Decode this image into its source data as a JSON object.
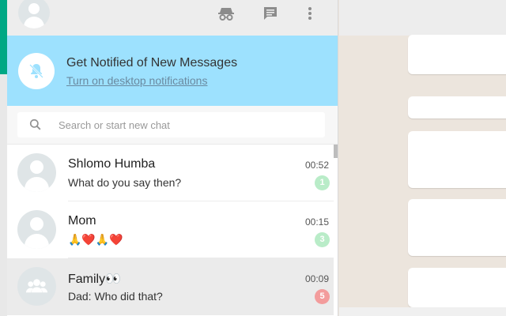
{
  "header": {
    "icons": [
      "avatar",
      "incognito-icon",
      "new-chat-icon",
      "menu-icon"
    ]
  },
  "notification": {
    "title": "Get Notified of New Messages",
    "link": "Turn on desktop notifications"
  },
  "search": {
    "placeholder": "Search or start new chat"
  },
  "chats": [
    {
      "name": "Shlomo Humba",
      "time": "00:52",
      "message": "What do you say then?",
      "unread": "1",
      "badge_color": "#b9ecc8",
      "avatar": "person",
      "active": false
    },
    {
      "name": "Mom",
      "time": "00:15",
      "message": "🙏❤️🙏❤️",
      "unread": "3",
      "badge_color": "#b9ecc8",
      "avatar": "person",
      "active": false
    },
    {
      "name": "Family👀",
      "time": "00:09",
      "message": "Dad: Who did that?",
      "unread": "5",
      "badge_color": "#f39c9c",
      "avatar": "group",
      "active": true
    }
  ],
  "colors": {
    "notification_bg": "#9de1fe",
    "accent_green": "#00a884",
    "header_bg": "#ededed",
    "unread_badge_green": "#b9ecc8",
    "unread_badge_red": "#f39c9c"
  }
}
